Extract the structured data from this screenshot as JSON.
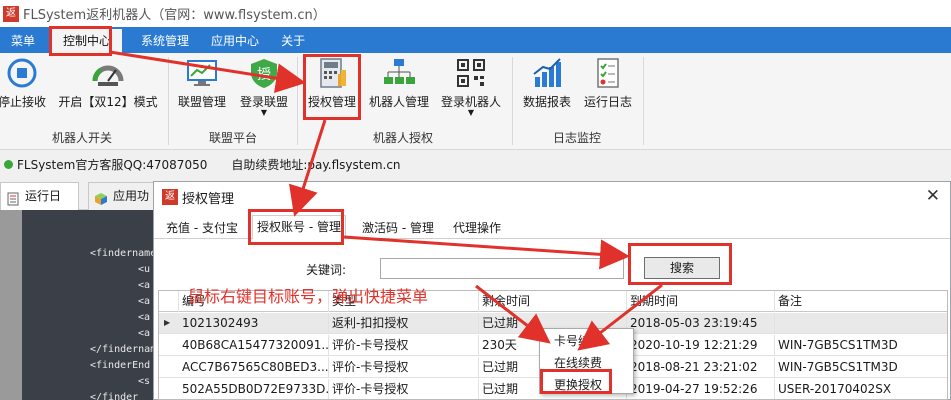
{
  "window": {
    "app_icon": "返",
    "title": "FLSystem返利机器人（官网：www.flsystem.cn）"
  },
  "menu": [
    "菜单",
    "控制中心",
    "系统管理",
    "应用中心",
    "关于"
  ],
  "ribbon": {
    "buttons": [
      {
        "id": "stop",
        "label": "停止接收",
        "icon": "stop-icon"
      },
      {
        "id": "mode",
        "label": "开启【双12】模式",
        "icon": "speedometer-icon"
      },
      {
        "id": "alliance",
        "label": "联盟管理",
        "icon": "monitor-chart-icon"
      },
      {
        "id": "login-alliance",
        "label": "登录联盟",
        "icon": "shield-auth-icon",
        "glyph": "授"
      },
      {
        "id": "auth",
        "label": "授权管理",
        "icon": "calculator-icon"
      },
      {
        "id": "robot",
        "label": "机器人管理",
        "icon": "network-icon"
      },
      {
        "id": "login-robot",
        "label": "登录机器人",
        "icon": "qrcode-icon"
      },
      {
        "id": "report",
        "label": "数据报表",
        "icon": "bar-chart-icon"
      },
      {
        "id": "log",
        "label": "运行日志",
        "icon": "checklist-icon"
      }
    ],
    "groups": [
      "机器人开关",
      "联盟平台",
      "机器人授权",
      "日志监控"
    ]
  },
  "info": {
    "qq": "FLSystem官方客服QQ:47087050",
    "pay": "自助续费地址:pay.flsystem.cn"
  },
  "main_tabs": [
    "运行日志",
    "应用功"
  ],
  "xml_lines": [
    "<findername",
    "<u",
    "<a",
    "<a",
    "<a",
    "<a",
    "</findernam",
    "<finderEnd",
    "<s",
    "</finder"
  ],
  "dialog": {
    "icon": "返",
    "title": "授权管理",
    "close": "✕",
    "tabs": [
      "充值 - 支付宝",
      "授权账号 - 管理",
      "激活码 - 管理",
      "代理操作"
    ],
    "keyword_label": "关键词:",
    "keyword_value": "",
    "search_label": "搜索",
    "columns": [
      "编号",
      "类型",
      "剩余时间",
      "到期时间",
      "备注"
    ],
    "rows": [
      {
        "mark": "▶",
        "cells": [
          "1021302493",
          "返利-扣扣授权",
          "已过期",
          "2018-05-03 23:19:45",
          ""
        ]
      },
      {
        "mark": "",
        "cells": [
          "40B68CA15477320091...",
          "评价-卡号授权",
          "230天",
          "2020-10-19 12:21:29",
          "WIN-7GB5CS1TM3D"
        ]
      },
      {
        "mark": "",
        "cells": [
          "ACC7B67565C80BED3...",
          "评价-卡号授权",
          "已过期",
          "2018-08-21 23:21:02",
          "WIN-7GB5CS1TM3D"
        ]
      },
      {
        "mark": "",
        "cells": [
          "502A55DB0D72E9733D...",
          "评价-卡号授权",
          "已过期",
          "2019-04-27 19:52:26",
          "USER-20170402SX"
        ]
      }
    ]
  },
  "context_menu": [
    "卡号续费",
    "在线续费",
    "更换授权"
  ],
  "annotation": "鼠标右键目标账号，弹出快捷菜单",
  "colors": {
    "menubar": "#2a7ad2",
    "highlight": "#e0322b",
    "app_icon": "#d03a2a"
  }
}
